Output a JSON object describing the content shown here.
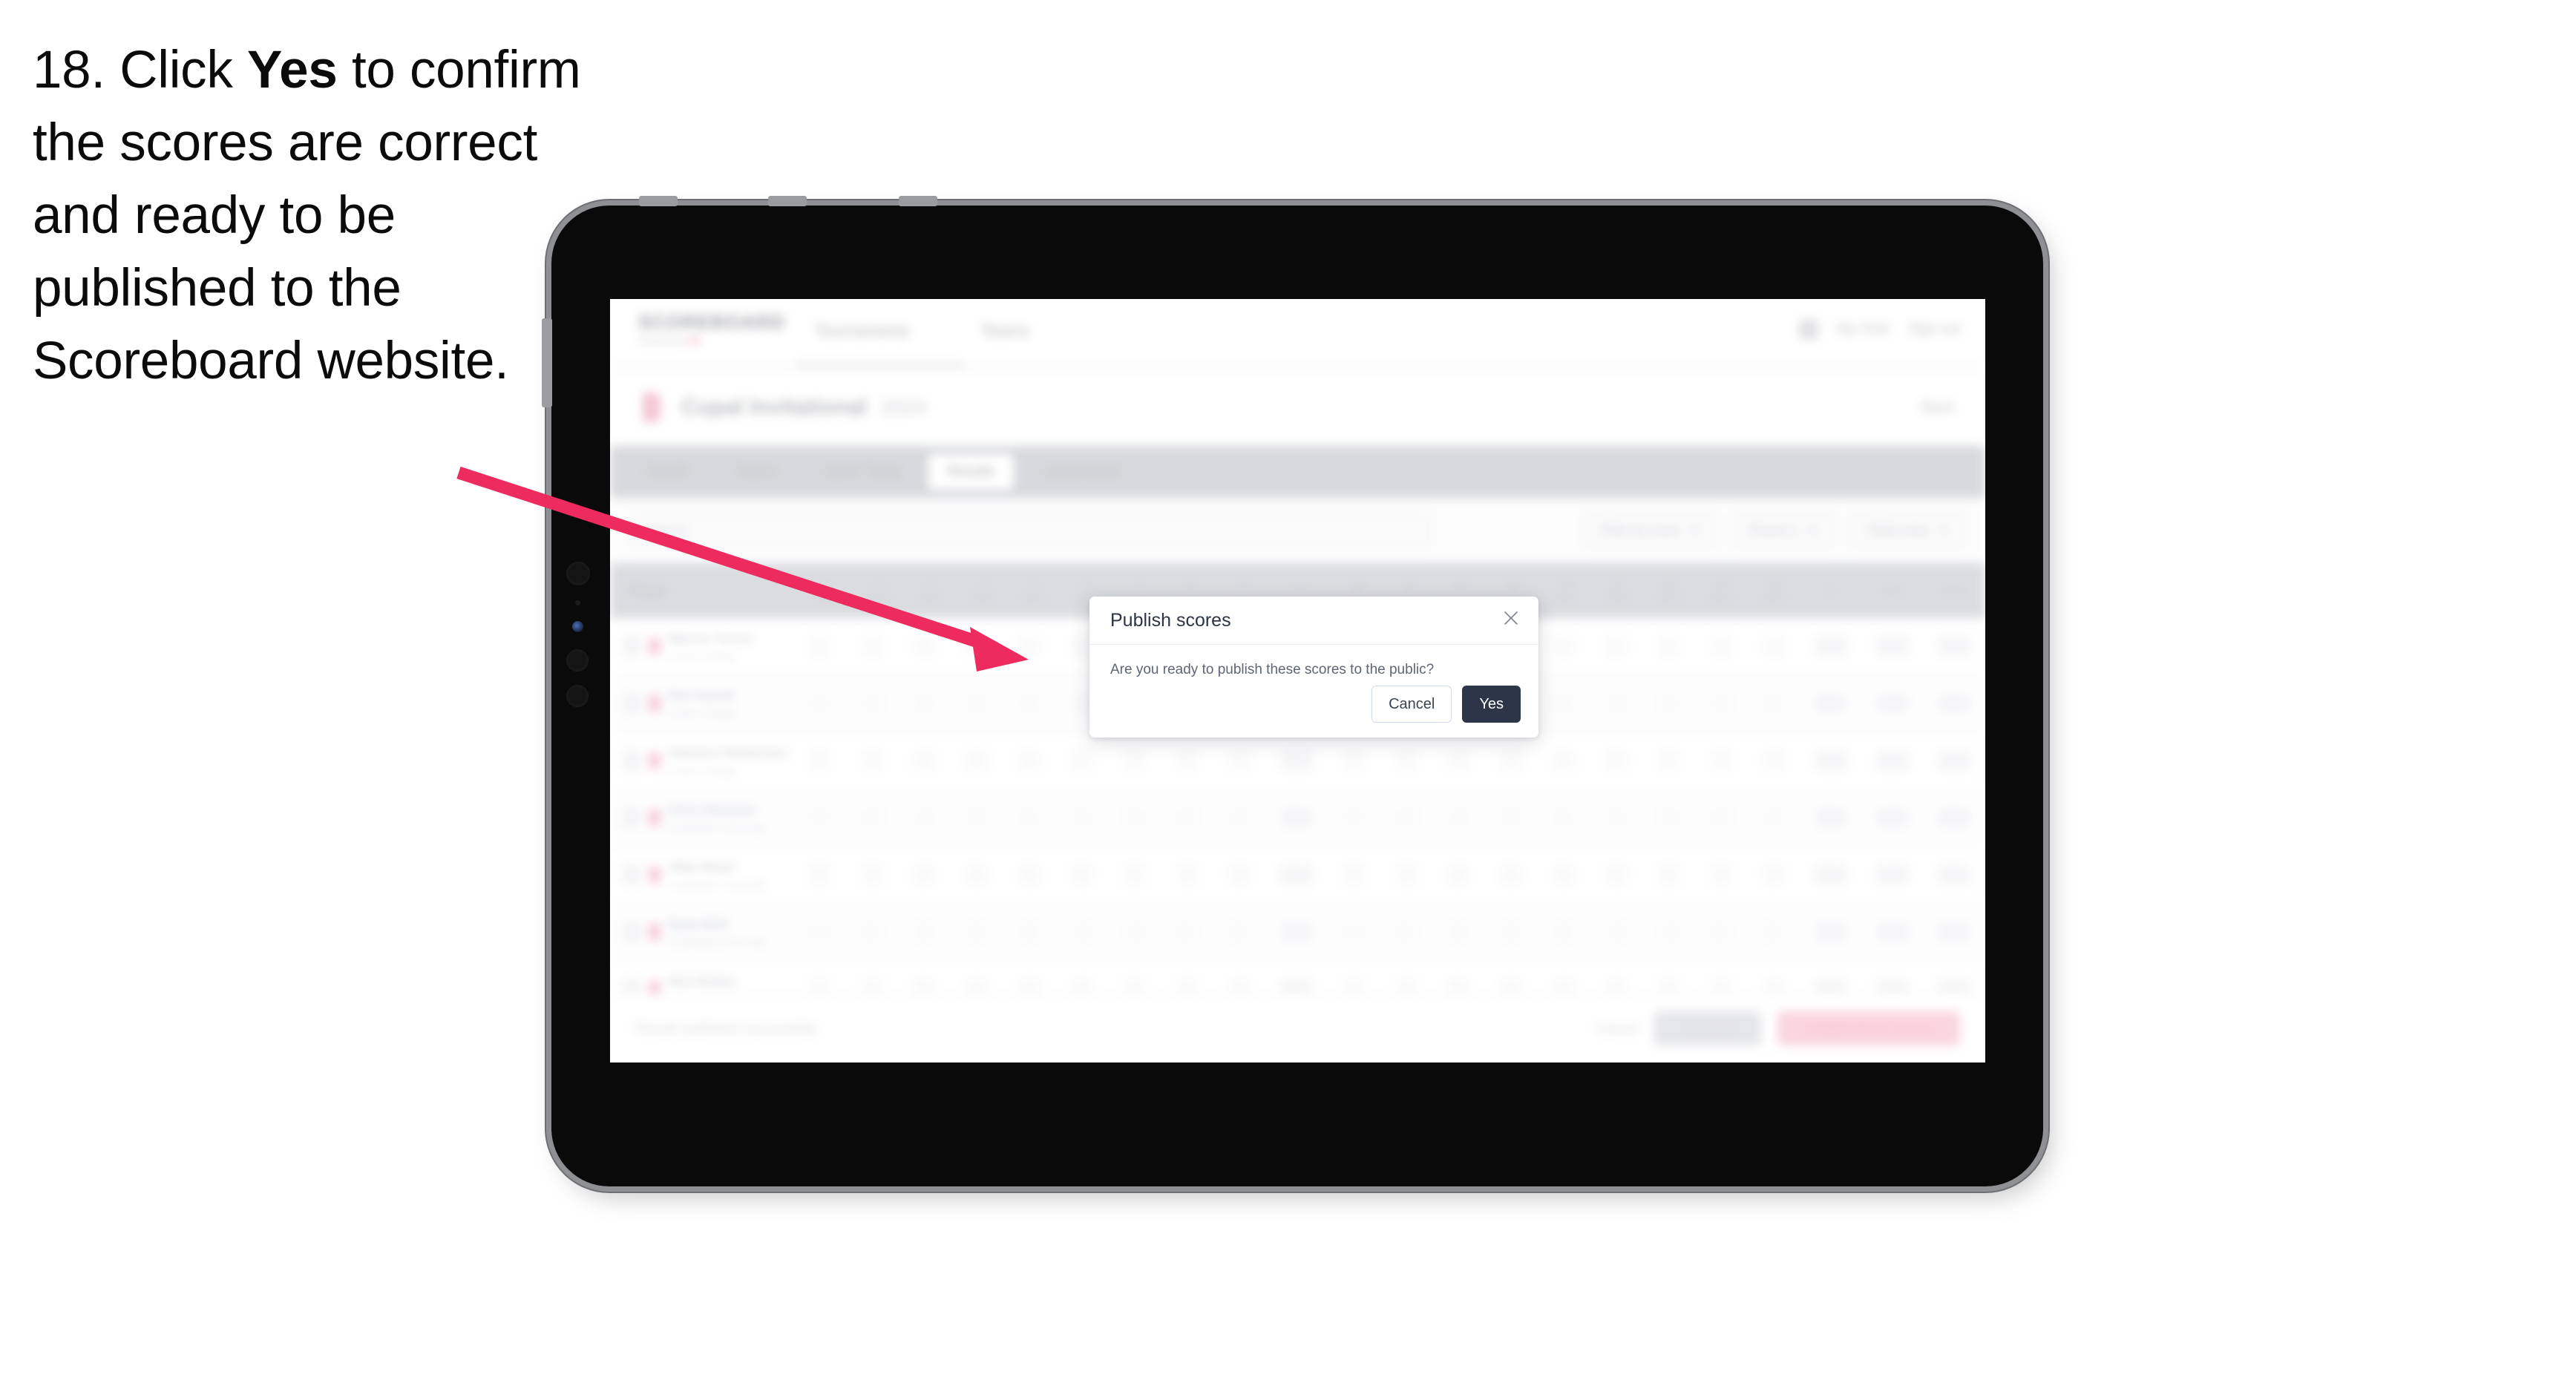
{
  "instruction": {
    "number": "18.",
    "before_bold": "Click ",
    "bold": "Yes",
    "after_bold": " to confirm the scores are correct and ready to be published to the Scoreboard website."
  },
  "annotation": {
    "arrow_color": "#ED2B5E",
    "arrow_name": "pointer-arrow"
  },
  "device": {
    "name": "tablet",
    "body_color": "#0a0a0a",
    "bezel_color": "#8e9094"
  },
  "webapp": {
    "nav": {
      "logo": "SCOREBOARD",
      "logo_sub_prefix": "Powered by ",
      "logo_sub_accent": "pink",
      "links": [
        "Tournaments",
        "Teams"
      ],
      "user_icon": "user-icon",
      "right_links": [
        "My Club",
        "Sign out"
      ]
    },
    "title_bar": {
      "flag_icon": "flag-icon",
      "title": "Cupal Invitational",
      "tag": "2024",
      "right_action": "Back"
    },
    "tabs": [
      {
        "label": "Details",
        "active": false
      },
      {
        "label": "Teams",
        "active": false
      },
      {
        "label": "Game Setup",
        "active": false
      },
      {
        "label": "Results",
        "active": true
      },
      {
        "label": "Leaderboard",
        "active": false
      }
    ],
    "filters": {
      "search_placeholder": "Search",
      "pills": [
        "Filter by score",
        "Round 1",
        "Table entry"
      ]
    },
    "table": {
      "columns": [
        {
          "num": "",
          "label": "Player",
          "kind": "player"
        },
        {
          "num": "1",
          "label": "Par 4",
          "kind": "hole"
        },
        {
          "num": "2",
          "label": "Par 3",
          "kind": "hole"
        },
        {
          "num": "3",
          "label": "Par 5",
          "kind": "hole"
        },
        {
          "num": "4",
          "label": "Par 4",
          "kind": "hole"
        },
        {
          "num": "5",
          "label": "Par 4",
          "kind": "hole"
        },
        {
          "num": "6",
          "label": "Par 3",
          "kind": "hole"
        },
        {
          "num": "7",
          "label": "Par 4",
          "kind": "hole"
        },
        {
          "num": "8",
          "label": "Par 5",
          "kind": "hole"
        },
        {
          "num": "9",
          "label": "Par 4",
          "kind": "hole"
        },
        {
          "num": "",
          "label": "Out",
          "kind": "wide"
        },
        {
          "num": "10",
          "label": "Par 4",
          "kind": "hole"
        },
        {
          "num": "11",
          "label": "Par 3",
          "kind": "hole"
        },
        {
          "num": "12",
          "label": "Par 5",
          "kind": "hole"
        },
        {
          "num": "13",
          "label": "Par 4",
          "kind": "hole"
        },
        {
          "num": "14",
          "label": "Par 4",
          "kind": "hole"
        },
        {
          "num": "15",
          "label": "Par 3",
          "kind": "hole"
        },
        {
          "num": "16",
          "label": "Par 4",
          "kind": "hole"
        },
        {
          "num": "17",
          "label": "Par 5",
          "kind": "hole"
        },
        {
          "num": "18",
          "label": "Par 4",
          "kind": "hole"
        },
        {
          "num": "",
          "label": "In",
          "kind": "wide"
        },
        {
          "num": "",
          "label": "Total",
          "kind": "wide"
        },
        {
          "num": "",
          "label": "Score",
          "kind": "wide"
        }
      ],
      "rows": [
        {
          "rank": "1",
          "name": "Warren Torres",
          "team": "Coach College"
        },
        {
          "rank": "2",
          "name": "Flor Farrell",
          "team": "Coach College"
        },
        {
          "rank": "3",
          "name": "Clarence Robertson",
          "team": "Coach College"
        },
        {
          "rank": "4",
          "name": "Chris Newman",
          "team": "Southwark University"
        },
        {
          "rank": "5",
          "name": "Allan Boyd",
          "team": "Southwark University"
        },
        {
          "rank": "6",
          "name": "Ryan Britt",
          "team": "Southwark University"
        },
        {
          "rank": "7",
          "name": "Nick Bailey",
          "team": "Southwark University"
        }
      ]
    },
    "footer": {
      "note": "Results published successfully",
      "ghost_action": "Cancel",
      "grey_action": "Save all",
      "pink_action": "Publish these scores"
    }
  },
  "modal": {
    "title": "Publish scores",
    "body": "Are you ready to publish these scores to the public?",
    "close_icon": "close-icon",
    "cancel_label": "Cancel",
    "yes_label": "Yes",
    "yes_color": "#2c3648",
    "cancel_border_color": "#cfd9ec"
  }
}
